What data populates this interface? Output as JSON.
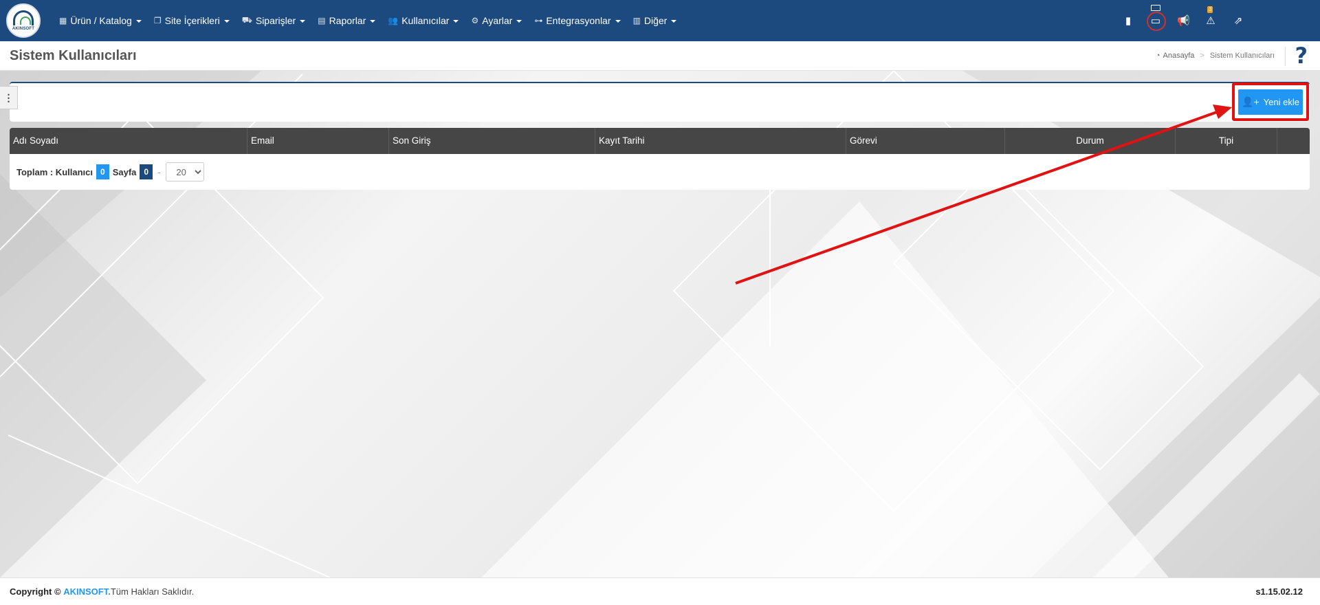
{
  "nav": {
    "logo_text": "AKINSOFT",
    "menu": [
      {
        "label": "Ürün / Katalog",
        "icon": "boxes-icon"
      },
      {
        "label": "Site İçerikleri",
        "icon": "documents-icon"
      },
      {
        "label": "Siparişler",
        "icon": "truck-icon"
      },
      {
        "label": "Raporlar",
        "icon": "report-icon"
      },
      {
        "label": "Kullanıcılar",
        "icon": "users-icon"
      },
      {
        "label": "Ayarlar",
        "icon": "cogs-icon"
      },
      {
        "label": "Entegrasyonlar",
        "icon": "network-icon"
      },
      {
        "label": "Diğer",
        "icon": "grid-icon"
      }
    ],
    "alerts_badge": "3"
  },
  "page": {
    "title": "Sistem Kullanıcıları",
    "breadcrumb_home": "Anasayfa",
    "breadcrumb_sep": ">",
    "breadcrumb_current": "Sistem Kullanıcıları",
    "help": "?"
  },
  "toolbar": {
    "add_button": "Yeni ekle",
    "side_toggle": "⋮"
  },
  "table": {
    "columns": [
      "Adı Soyadı",
      "Email",
      "Son Giriş",
      "Kayıt Tarihi",
      "Görevi",
      "Durum",
      "Tipi",
      ""
    ]
  },
  "pager": {
    "total_label": "Toplam : Kullanıcı",
    "total_value": "0",
    "page_label": "Sayfa",
    "page_value": "0",
    "dash": "-",
    "page_size": "20"
  },
  "footer": {
    "copyright": "Copyright ©",
    "brand": "AKINSOFT.",
    "rights": "Tüm Hakları Saklıdır.",
    "version": "s1.15.02.12"
  },
  "colors": {
    "nav_bg": "#1c4a7e",
    "accent": "#2196f3",
    "highlight": "#e01212",
    "table_head": "#464646"
  }
}
